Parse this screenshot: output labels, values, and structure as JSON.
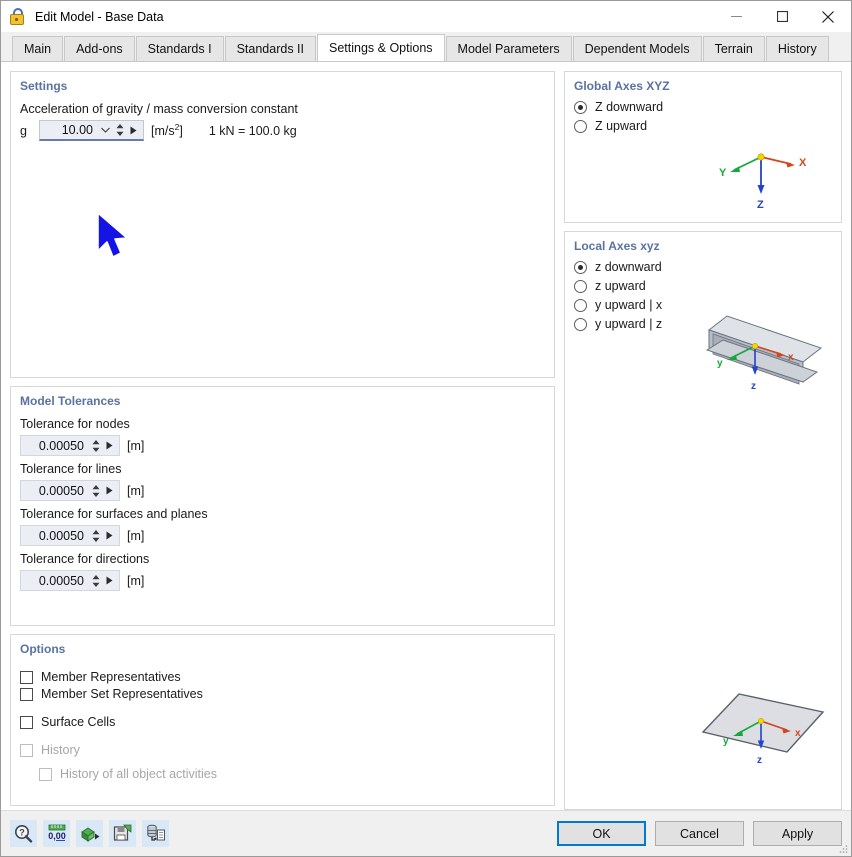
{
  "window": {
    "title": "Edit Model - Base Data",
    "icon": "lock-icon",
    "controls": {
      "minimize": "minimize-icon",
      "maximize": "maximize-icon",
      "close": "close-icon"
    }
  },
  "tabs": [
    {
      "label": "Main",
      "active": false
    },
    {
      "label": "Add-ons",
      "active": false
    },
    {
      "label": "Standards I",
      "active": false
    },
    {
      "label": "Standards II",
      "active": false
    },
    {
      "label": "Settings & Options",
      "active": true
    },
    {
      "label": "Model Parameters",
      "active": false
    },
    {
      "label": "Dependent Models",
      "active": false
    },
    {
      "label": "Terrain",
      "active": false
    },
    {
      "label": "History",
      "active": false
    }
  ],
  "settings": {
    "title": "Settings",
    "gravity_label": "Acceleration of gravity / mass conversion constant",
    "gravity_symbol": "g",
    "gravity_value": "10.00",
    "gravity_unit_prefix": "[m/s",
    "gravity_unit_exponent": "2",
    "gravity_unit_suffix": "]",
    "conversion_text": "1 kN = 100.0 kg"
  },
  "tolerances": {
    "title": "Model Tolerances",
    "items": [
      {
        "label": "Tolerance for nodes",
        "value": "0.00050",
        "unit": "[m]"
      },
      {
        "label": "Tolerance for lines",
        "value": "0.00050",
        "unit": "[m]"
      },
      {
        "label": "Tolerance for surfaces and planes",
        "value": "0.00050",
        "unit": "[m]"
      },
      {
        "label": "Tolerance for directions",
        "value": "0.00050",
        "unit": "[m]"
      }
    ]
  },
  "options": {
    "title": "Options",
    "items": [
      {
        "label": "Member Representatives",
        "checked": false,
        "disabled": false,
        "indent": false
      },
      {
        "label": "Member Set Representatives",
        "checked": false,
        "disabled": false,
        "indent": false
      },
      {
        "label": "Surface Cells",
        "checked": false,
        "disabled": false,
        "indent": false
      },
      {
        "label": "History",
        "checked": false,
        "disabled": true,
        "indent": false
      },
      {
        "label": "History of all object activities",
        "checked": false,
        "disabled": true,
        "indent": true
      }
    ]
  },
  "global_axes": {
    "title": "Global Axes XYZ",
    "options": [
      {
        "label": "Z downward",
        "selected": true
      },
      {
        "label": "Z upward",
        "selected": false
      }
    ],
    "gizmo": {
      "x_label": "X",
      "y_label": "Y",
      "z_label": "Z",
      "x_color": "#d4451e",
      "y_color": "#17a83c",
      "z_color": "#2244cc",
      "origin_color": "#f5d400"
    }
  },
  "local_axes": {
    "title": "Local Axes xyz",
    "options": [
      {
        "label": "z downward",
        "selected": true
      },
      {
        "label": "z upward",
        "selected": false
      },
      {
        "label": "y upward | x",
        "selected": false
      },
      {
        "label": "y upward | z",
        "selected": false
      }
    ],
    "beam_gizmo": {
      "x_label": "x",
      "y_label": "y",
      "z_label": "z"
    },
    "surface_gizmo": {
      "x_label": "x",
      "y_label": "y",
      "z_label": "z"
    }
  },
  "footer": {
    "toolbar": [
      {
        "name": "help-search-icon"
      },
      {
        "name": "units-ruler-icon"
      },
      {
        "name": "export-cube-icon"
      },
      {
        "name": "save-defaults-icon"
      },
      {
        "name": "database-document-icon"
      }
    ],
    "buttons": [
      {
        "label": "OK",
        "default": true
      },
      {
        "label": "Cancel",
        "default": false
      },
      {
        "label": "Apply",
        "default": false
      }
    ]
  },
  "annotation": {
    "cursor": "mouse-pointer-arrow",
    "color": "#1414e6"
  }
}
